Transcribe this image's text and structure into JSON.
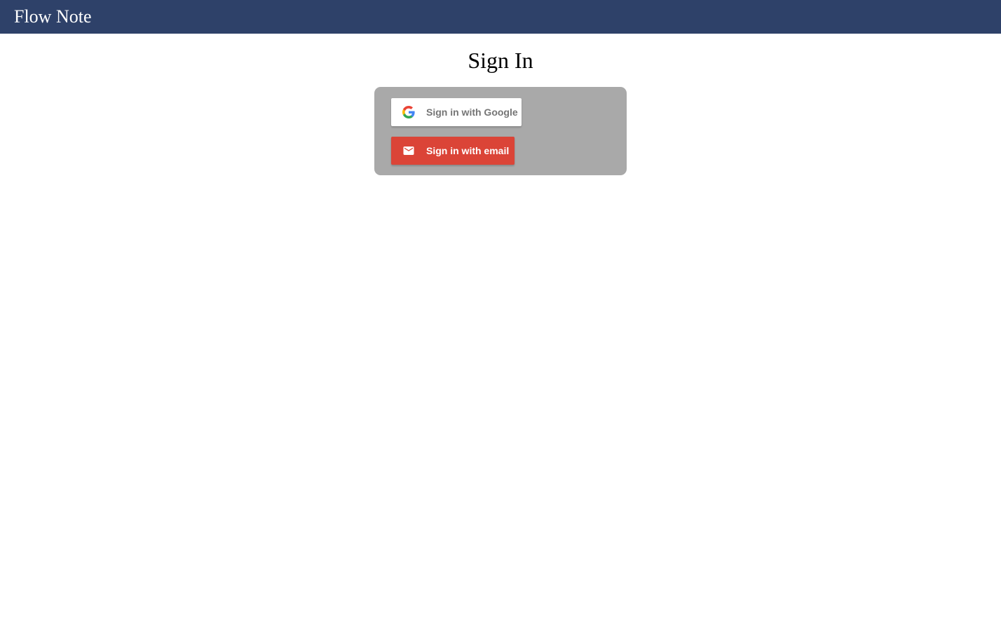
{
  "header": {
    "app_title": "Flow Note"
  },
  "main": {
    "page_title": "Sign In"
  },
  "auth": {
    "google_button_label": "Sign in with Google",
    "email_button_label": "Sign in with email",
    "google_icon": "google-g-icon",
    "email_icon": "mail-envelope-icon"
  },
  "colors": {
    "header_bg": "#2e4169",
    "card_bg": "#a9a9a9",
    "google_button_bg": "#ffffff",
    "email_button_bg": "#db4437"
  }
}
